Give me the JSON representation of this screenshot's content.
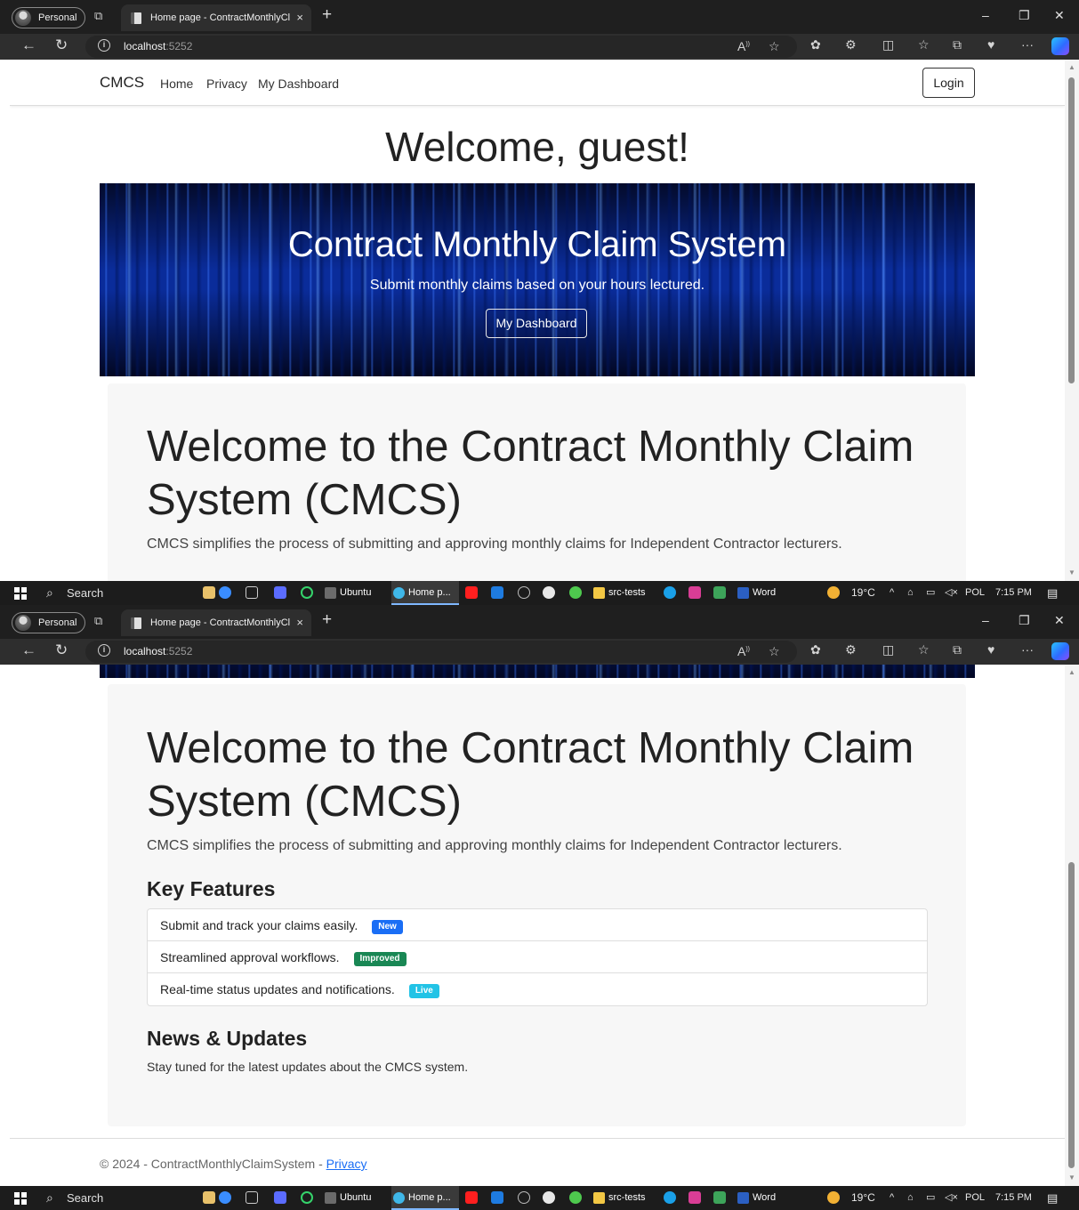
{
  "browser": {
    "profile_label": "Personal",
    "tab_title": "Home page - ContractMonthlyCla",
    "tab_close": "×",
    "new_tab": "+",
    "url_host": "localhost",
    "url_port": ":5252",
    "window_controls": {
      "minimize": "–",
      "restore": "❐",
      "close": "✕"
    },
    "toolbar_icons": [
      "read-aloud-icon",
      "favorite-star-icon",
      "extension-icon",
      "puzzle-icon",
      "split-screen-icon",
      "favorites-list-icon",
      "collections-icon",
      "performance-icon",
      "more-icon",
      "copilot-icon"
    ]
  },
  "navbar": {
    "brand": "CMCS",
    "links": [
      "Home",
      "Privacy",
      "My Dashboard"
    ],
    "login": "Login"
  },
  "welcome_guest": "Welcome, guest!",
  "hero": {
    "title": "Contract Monthly Claim System",
    "subtitle": "Submit monthly claims based on your hours lectured.",
    "button": "My Dashboard"
  },
  "intro": {
    "heading": "Welcome to the Contract Monthly Claim System (CMCS)",
    "lead": "CMCS simplifies the process of submitting and approving monthly claims for Independent Contractor lecturers."
  },
  "features": {
    "heading": "Key Features",
    "items": [
      {
        "text": "Submit and track your claims easily.",
        "badge": "New",
        "badge_color": "#1a6ef5"
      },
      {
        "text": "Streamlined approval workflows.",
        "badge": "Improved",
        "badge_color": "#198754"
      },
      {
        "text": "Real-time status updates and notifications.",
        "badge": "Live",
        "badge_color": "#22c3e6"
      }
    ]
  },
  "news": {
    "heading": "News & Updates",
    "text": "Stay tuned for the latest updates about the CMCS system."
  },
  "footer": {
    "text": "© 2024 - ContractMonthlyClaimSystem - ",
    "link": "Privacy"
  },
  "taskbar": {
    "search": "Search",
    "apps": [
      "Ubuntu",
      "Home p...",
      "src-tests",
      "Word"
    ],
    "weather": "19°C",
    "language": "POL",
    "time": "7:15 PM"
  }
}
